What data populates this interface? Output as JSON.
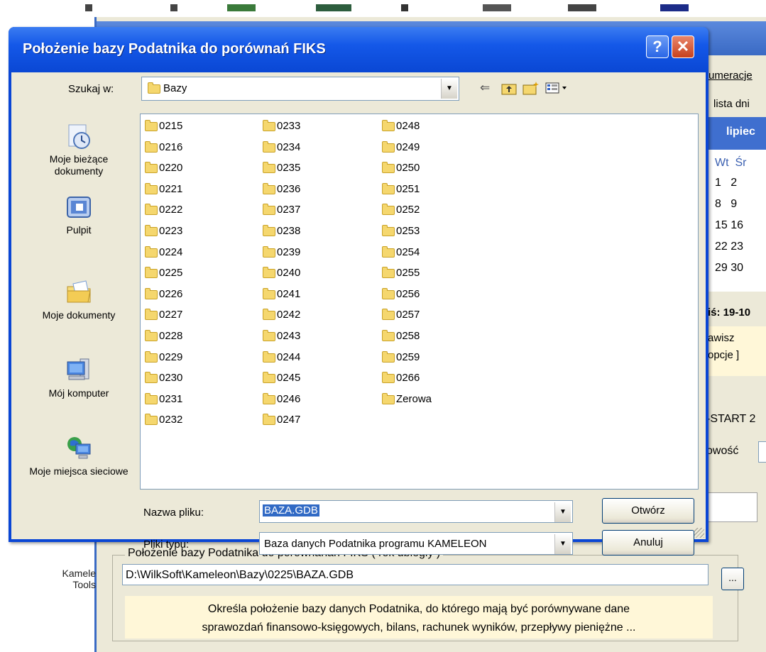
{
  "dialog": {
    "title": "Położenie bazy Podatnika do porównań FIKS",
    "help_symbol": "?",
    "close_symbol": "✕",
    "look_in_label": "Szukaj w:",
    "look_in_value": "Bazy",
    "places": [
      {
        "label": "Moje bieżące dokumenty",
        "icon": "recent-documents-icon"
      },
      {
        "label": "Pulpit",
        "icon": "desktop-icon"
      },
      {
        "label": "Moje dokumenty",
        "icon": "my-documents-icon"
      },
      {
        "label": "Mój komputer",
        "icon": "my-computer-icon"
      },
      {
        "label": "Moje miejsca sieciowe",
        "icon": "network-places-icon"
      }
    ],
    "folders": [
      [
        "0215",
        "0216",
        "0220",
        "0221",
        "0222",
        "0223",
        "0224",
        "0225",
        "0226",
        "0227",
        "0228",
        "0229",
        "0230",
        "0231",
        "0232"
      ],
      [
        "0233",
        "0234",
        "0235",
        "0236",
        "0237",
        "0238",
        "0239",
        "0240",
        "0241",
        "0242",
        "0243",
        "0244",
        "0245",
        "0246",
        "0247"
      ],
      [
        "0248",
        "0249",
        "0250",
        "0251",
        "0252",
        "0253",
        "0254",
        "0255",
        "0256",
        "0257",
        "0258",
        "0259",
        "0266",
        "Zerowa"
      ]
    ],
    "file_name_label": "Nazwa pliku:",
    "file_name_value": "BAZA.GDB",
    "file_type_label": "Pliki typu:",
    "file_type_value": "Baza danych Podatnika programu KAMELEON",
    "open_button": "Otwórz",
    "cancel_button": "Anuluj"
  },
  "background": {
    "right_panel": {
      "tab_text": "umeracje",
      "list_text": "lista dni",
      "month": "lipiec",
      "weekday_1": "Wt",
      "weekday_2": "Śr",
      "weeks": [
        [
          "1",
          "2"
        ],
        [
          "8",
          "9"
        ],
        [
          "15",
          "16"
        ],
        [
          "22",
          "23"
        ],
        [
          "29",
          "30"
        ]
      ],
      "date_text": "iś: 19-10",
      "hint_line_1": "awisz",
      "hint_line_2": "opcje ]",
      "start_text": "-START 2",
      "field_label": "owość"
    },
    "group": {
      "legend": "Położenie bazy Podatnika do porównanań FIKS ( rok ubiegły )",
      "path": "D:\\WilkSoft\\Kameleon\\Bazy\\0225\\BAZA.GDB",
      "browse_label": "...",
      "description_line_1": "Określa położenie bazy danych Podatnika, do którego mają być porównywane dane",
      "description_line_2": "sprawozdań finansowo-księgowych, bilans, rachunek wyników, przepływy pieniężne ..."
    },
    "left_label_1": "Kamele",
    "left_label_2": "Tools"
  }
}
